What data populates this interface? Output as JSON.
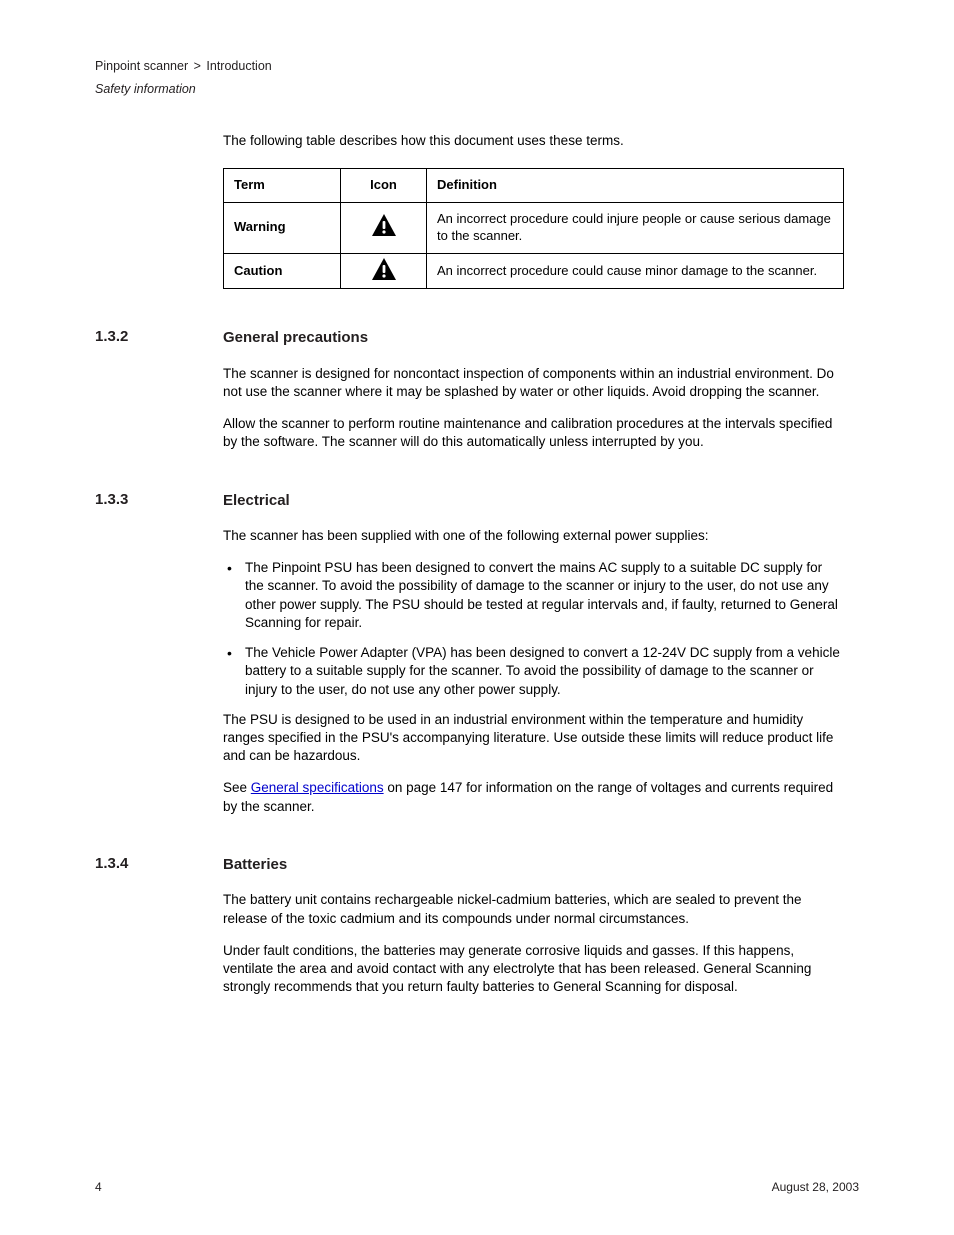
{
  "breadcrumbs": {
    "item1": "Pinpoint scanner",
    "item2": "Introduction"
  },
  "title": "Safety information",
  "intro": "The following table describes how this document uses these terms.",
  "table": {
    "headers": {
      "term": "Term",
      "icon": "Icon",
      "definition": "Definition"
    },
    "rows": [
      {
        "term": "Warning",
        "definition": "An incorrect procedure could injure people or cause serious damage to the scanner."
      },
      {
        "term": "Caution",
        "definition": "An incorrect procedure could cause minor damage to the scanner."
      }
    ]
  },
  "sections": [
    {
      "id": "1.3.2",
      "heading": "General precautions",
      "paragraphs": [
        "The scanner is designed for noncontact inspection of components within an industrial environment. Do not use the scanner where it may be splashed by water or other liquids. Avoid dropping the scanner.",
        "Allow the scanner to perform routine maintenance and calibration procedures at the intervals specified by the software. The scanner will do this automatically unless interrupted by you."
      ]
    },
    {
      "id": "1.3.3",
      "heading": "Electrical",
      "paragraphs": [
        "The scanner has been supplied with one of the following external power supplies:"
      ],
      "list": [
        "The Pinpoint PSU has been designed to convert the mains AC supply to a suitable DC supply for the scanner. To avoid the possibility of damage to the scanner or injury to the user, do not use any other power supply. The PSU should be tested at regular intervals and, if faulty, returned to General Scanning for repair.",
        "The Vehicle Power Adapter (VPA) has been designed to convert a 12-24V DC supply from a vehicle battery to a suitable supply for the scanner. To avoid the possibility of damage to the scanner or injury to the user, do not use any other power supply."
      ],
      "post_paragraphs": [
        "The PSU is designed to be used in an industrial environment within the temperature and humidity ranges specified in the PSU's accompanying literature. Use outside these limits will reduce product life and can be hazardous.",
        {
          "pre": "See ",
          "link_text": "General specifications",
          "post": " on page 147 for information on the range of voltages and currents required by the scanner."
        }
      ]
    },
    {
      "id": "1.3.4",
      "heading": "Batteries",
      "paragraphs": [
        "The battery unit contains rechargeable nickel-cadmium batteries, which are sealed to prevent the release of the toxic cadmium and its compounds under normal circumstances.",
        "Under fault conditions, the batteries may generate corrosive liquids and gasses. If this happens, ventilate the area and avoid contact with any electrolyte that has been released. General Scanning strongly recommends that you return faulty batteries to General Scanning for disposal."
      ]
    }
  ],
  "footer": {
    "page": "4",
    "date": "August 28, 2003"
  }
}
